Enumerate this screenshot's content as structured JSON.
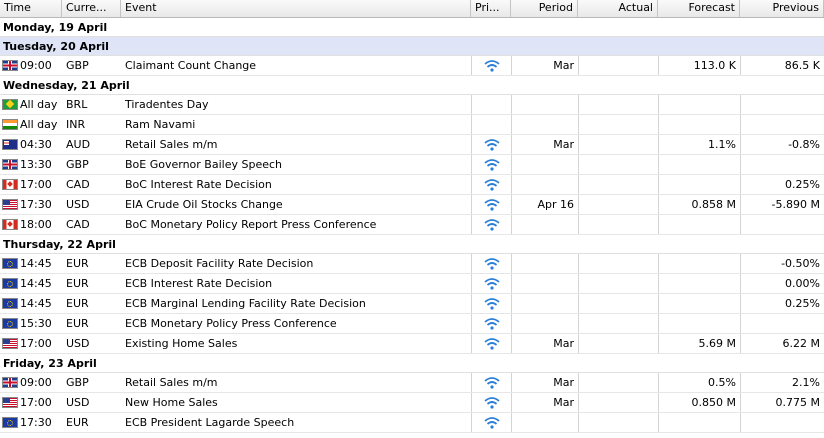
{
  "columns": {
    "time": "Time",
    "currency": "Curre...",
    "event": "Event",
    "priority": "Pri...",
    "period": "Period",
    "actual": "Actual",
    "forecast": "Forecast",
    "previous": "Previous"
  },
  "days": [
    {
      "label": "Monday, 19 April",
      "selected": false,
      "events": []
    },
    {
      "label": "Tuesday, 20 April",
      "selected": true,
      "events": [
        {
          "flag": "flag-gb",
          "time": "09:00",
          "currency": "GBP",
          "event": "Claimant Count Change",
          "priority": true,
          "period": "Mar",
          "actual": "",
          "forecast": "113.0 K",
          "previous": "86.5 K"
        }
      ]
    },
    {
      "label": "Wednesday, 21 April",
      "selected": false,
      "events": [
        {
          "flag": "flag-br",
          "time": "All day",
          "currency": "BRL",
          "event": "Tiradentes Day",
          "priority": false,
          "period": "",
          "actual": "",
          "forecast": "",
          "previous": ""
        },
        {
          "flag": "flag-in",
          "time": "All day",
          "currency": "INR",
          "event": "Ram Navami",
          "priority": false,
          "period": "",
          "actual": "",
          "forecast": "",
          "previous": ""
        },
        {
          "flag": "flag-au",
          "time": "04:30",
          "currency": "AUD",
          "event": "Retail Sales m/m",
          "priority": true,
          "period": "Mar",
          "actual": "",
          "forecast": "1.1%",
          "previous": "-0.8%"
        },
        {
          "flag": "flag-gb",
          "time": "13:30",
          "currency": "GBP",
          "event": "BoE Governor Bailey Speech",
          "priority": true,
          "period": "",
          "actual": "",
          "forecast": "",
          "previous": ""
        },
        {
          "flag": "flag-ca",
          "time": "17:00",
          "currency": "CAD",
          "event": "BoC Interest Rate Decision",
          "priority": true,
          "period": "",
          "actual": "",
          "forecast": "",
          "previous": "0.25%"
        },
        {
          "flag": "flag-us",
          "time": "17:30",
          "currency": "USD",
          "event": "EIA Crude Oil Stocks Change",
          "priority": true,
          "period": "Apr 16",
          "actual": "",
          "forecast": "0.858 M",
          "previous": "-5.890 M"
        },
        {
          "flag": "flag-ca",
          "time": "18:00",
          "currency": "CAD",
          "event": "BoC Monetary Policy Report Press Conference",
          "priority": true,
          "period": "",
          "actual": "",
          "forecast": "",
          "previous": ""
        }
      ]
    },
    {
      "label": "Thursday, 22 April",
      "selected": false,
      "events": [
        {
          "flag": "flag-eu",
          "time": "14:45",
          "currency": "EUR",
          "event": "ECB Deposit Facility Rate Decision",
          "priority": true,
          "period": "",
          "actual": "",
          "forecast": "",
          "previous": "-0.50%"
        },
        {
          "flag": "flag-eu",
          "time": "14:45",
          "currency": "EUR",
          "event": "ECB Interest Rate Decision",
          "priority": true,
          "period": "",
          "actual": "",
          "forecast": "",
          "previous": "0.00%"
        },
        {
          "flag": "flag-eu",
          "time": "14:45",
          "currency": "EUR",
          "event": "ECB Marginal Lending Facility Rate Decision",
          "priority": true,
          "period": "",
          "actual": "",
          "forecast": "",
          "previous": "0.25%"
        },
        {
          "flag": "flag-eu",
          "time": "15:30",
          "currency": "EUR",
          "event": "ECB Monetary Policy Press Conference",
          "priority": true,
          "period": "",
          "actual": "",
          "forecast": "",
          "previous": ""
        },
        {
          "flag": "flag-us",
          "time": "17:00",
          "currency": "USD",
          "event": "Existing Home Sales",
          "priority": true,
          "period": "Mar",
          "actual": "",
          "forecast": "5.69 M",
          "previous": "6.22 M"
        }
      ]
    },
    {
      "label": "Friday, 23 April",
      "selected": false,
      "events": [
        {
          "flag": "flag-gb",
          "time": "09:00",
          "currency": "GBP",
          "event": "Retail Sales m/m",
          "priority": true,
          "period": "Mar",
          "actual": "",
          "forecast": "0.5%",
          "previous": "2.1%"
        },
        {
          "flag": "flag-us",
          "time": "17:00",
          "currency": "USD",
          "event": "New Home Sales",
          "priority": true,
          "period": "Mar",
          "actual": "",
          "forecast": "0.850 M",
          "previous": "0.775 M"
        },
        {
          "flag": "flag-eu",
          "time": "17:30",
          "currency": "EUR",
          "event": "ECB President Lagarde Speech",
          "priority": true,
          "period": "",
          "actual": "",
          "forecast": "",
          "previous": ""
        }
      ]
    }
  ],
  "colors": {
    "priority_icon": "#2b7fd8",
    "selected_day": "#dfe5f7"
  }
}
